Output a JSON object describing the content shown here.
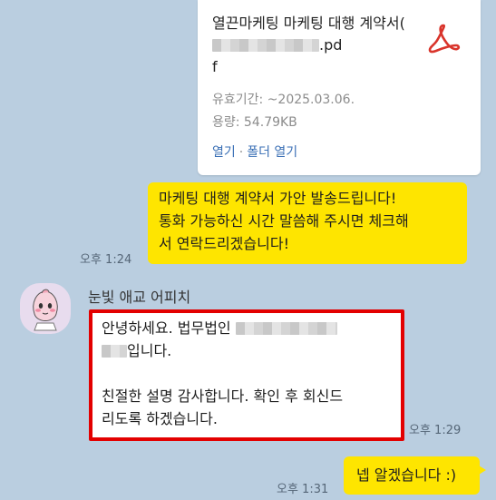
{
  "file_card": {
    "title_part1": "열끈마케팅 마케팅 대행 계약서(",
    "title_part2": ".pd",
    "title_part3": "f",
    "expire": "유효기간: ~2025.03.06.",
    "size": "용량: 54.79KB",
    "open_label": "열기",
    "separator": "·",
    "open_folder_label": "폴더 열기",
    "icon": "pdf-icon",
    "icon_color": "#d9342b"
  },
  "messages": {
    "msg1": {
      "line1": "마케팅 대행 계약서 가안 발송드립니다!",
      "line2": "통화 가능하신 시간 말씀해 주시면 체크해",
      "line3": "서 연락드리겠습니다!",
      "time": "오후 1:24"
    },
    "msg2": {
      "sender": "눈빛 애교 어피치",
      "avatar": "apeach-avatar",
      "line1a": "안녕하세요. 법무법인 ",
      "line2b": "입니다.",
      "line4": "친절한 설명 감사합니다. 확인 후 회신드",
      "line5": "리도록 하겠습니다.",
      "time": "오후 1:29"
    },
    "msg3": {
      "text": "넵 알겠습니다 :)",
      "time": "오후 1:31"
    }
  },
  "colors": {
    "background": "#bacee0",
    "my_bubble": "#fee500",
    "highlight_border": "#e30000"
  }
}
